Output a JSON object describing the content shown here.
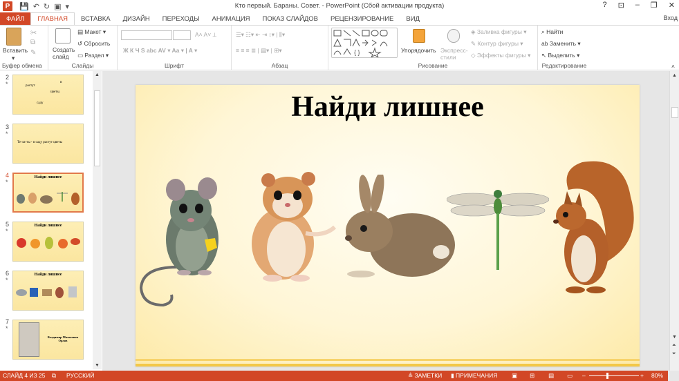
{
  "window": {
    "title": "Кто первый. Бараны. Совет. - PowerPoint (Сбой активации продукта)",
    "signin": "Вход",
    "controls": [
      "?",
      "⊡",
      "–",
      "❐",
      "✕"
    ]
  },
  "tabs": [
    "ФАЙЛ",
    "ГЛАВНАЯ",
    "ВСТАВКА",
    "ДИЗАЙН",
    "ПЕРЕХОДЫ",
    "АНИМАЦИЯ",
    "ПОКАЗ СЛАЙДОВ",
    "РЕЦЕНЗИРОВАНИЕ",
    "ВИД"
  ],
  "ribbon": {
    "clipboard": {
      "label": "Буфер обмена",
      "paste": "Вставить"
    },
    "slides": {
      "label": "Слайды",
      "new_slide": "Создать слайд",
      "layout": "Макет",
      "reset": "Сбросить",
      "section": "Раздел"
    },
    "font": {
      "label": "Шрифт"
    },
    "paragraph": {
      "label": "Абзац"
    },
    "drawing": {
      "label": "Рисование",
      "arrange": "Упорядочить",
      "quick_styles": "Экспресс-стили",
      "fill": "Заливка фигуры",
      "outline": "Контур фигуры",
      "effects": "Эффекты фигуры"
    },
    "editing": {
      "label": "Редактирование",
      "find": "Найти",
      "replace": "Заменить",
      "select": "Выделить"
    }
  },
  "thumbnails": [
    {
      "num": "2",
      "star": "*",
      "lines": [
        "растут",
        "в",
        "цветы.",
        "саду"
      ]
    },
    {
      "num": "3",
      "star": "*",
      "text": "Те-ла-ты -   в саду растут цветы"
    },
    {
      "num": "4",
      "star": "*",
      "title": "Найди лишнее",
      "selected": true
    },
    {
      "num": "5",
      "star": "*",
      "title": "Найди лишнее"
    },
    {
      "num": "6",
      "star": "*",
      "title": "Найди лишнее"
    },
    {
      "num": "7",
      "star": "*",
      "caption": "Владимир Матвеевич Орлов"
    }
  ],
  "slide": {
    "title": "Найди лишнее",
    "images": [
      "mouse-image",
      "hamster-image",
      "rabbit-image",
      "dragonfly-image",
      "squirrel-image"
    ]
  },
  "status": {
    "slide_info": "СЛАЙД 4 ИЗ 25",
    "language": "РУССКИЙ",
    "notes": "ЗАМЕТКИ",
    "comments": "ПРИМЕЧАНИЯ",
    "zoom": "80%"
  }
}
